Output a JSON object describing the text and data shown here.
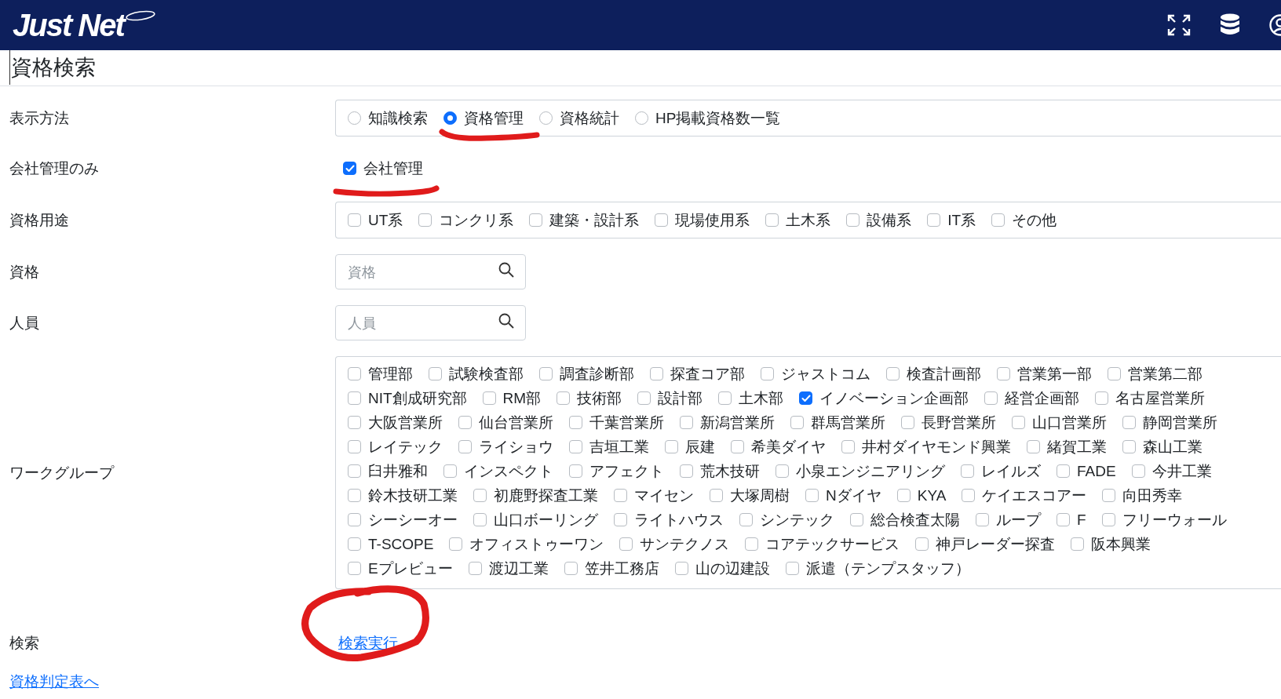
{
  "header": {
    "logo": "Just Net"
  },
  "page_title": "資格検索",
  "rows": [
    {
      "kind": "radio",
      "label": "表示方法",
      "options": [
        {
          "label": "知識検索",
          "selected": false
        },
        {
          "label": "資格管理",
          "selected": true
        },
        {
          "label": "資格統計",
          "selected": false
        },
        {
          "label": "HP掲載資格数一覧",
          "selected": false
        }
      ]
    },
    {
      "kind": "check",
      "label": "会社管理のみ",
      "options": [
        {
          "label": "会社管理",
          "checked": true
        }
      ]
    },
    {
      "kind": "checks",
      "label": "資格用途",
      "options": [
        {
          "label": "UT系",
          "checked": false
        },
        {
          "label": "コンクリ系",
          "checked": false
        },
        {
          "label": "建築・設計系",
          "checked": false
        },
        {
          "label": "現場使用系",
          "checked": false
        },
        {
          "label": "土木系",
          "checked": false
        },
        {
          "label": "設備系",
          "checked": false
        },
        {
          "label": "IT系",
          "checked": false
        },
        {
          "label": "その他",
          "checked": false
        }
      ]
    },
    {
      "kind": "search",
      "label": "資格",
      "placeholder": "資格"
    },
    {
      "kind": "search",
      "label": "人員",
      "placeholder": "人員"
    },
    {
      "kind": "grid",
      "label": "ワークグループ",
      "lines": [
        {
          "options": [
            {
              "label": "管理部",
              "checked": false
            },
            {
              "label": "試験検査部",
              "checked": false
            },
            {
              "label": "調査診断部",
              "checked": false
            },
            {
              "label": "探査コア部",
              "checked": false
            },
            {
              "label": "ジャストコム",
              "checked": false
            },
            {
              "label": "検査計画部",
              "checked": false
            },
            {
              "label": "営業第一部",
              "checked": false
            },
            {
              "label": "営業第二部",
              "checked": false
            }
          ]
        },
        {
          "options": [
            {
              "label": "NIT創成研究部",
              "checked": false
            },
            {
              "label": "RM部",
              "checked": false
            },
            {
              "label": "技術部",
              "checked": false
            },
            {
              "label": "設計部",
              "checked": false
            },
            {
              "label": "土木部",
              "checked": false
            },
            {
              "label": "イノベーション企画部",
              "checked": true
            },
            {
              "label": "経営企画部",
              "checked": false
            },
            {
              "label": "名古屋営業所",
              "checked": false
            }
          ]
        },
        {
          "options": [
            {
              "label": "大阪営業所",
              "checked": false
            },
            {
              "label": "仙台営業所",
              "checked": false
            },
            {
              "label": "千葉営業所",
              "checked": false
            },
            {
              "label": "新潟営業所",
              "checked": false
            },
            {
              "label": "群馬営業所",
              "checked": false
            },
            {
              "label": "長野営業所",
              "checked": false
            },
            {
              "label": "山口営業所",
              "checked": false
            },
            {
              "label": "静岡営業所",
              "checked": false
            }
          ]
        },
        {
          "options": [
            {
              "label": "レイテック",
              "checked": false
            },
            {
              "label": "ライショウ",
              "checked": false
            },
            {
              "label": "吉垣工業",
              "checked": false
            },
            {
              "label": "辰建",
              "checked": false
            },
            {
              "label": "希美ダイヤ",
              "checked": false
            },
            {
              "label": "井村ダイヤモンド興業",
              "checked": false
            },
            {
              "label": "緒賀工業",
              "checked": false
            },
            {
              "label": "森山工業",
              "checked": false
            }
          ]
        },
        {
          "options": [
            {
              "label": "臼井雅和",
              "checked": false
            },
            {
              "label": "インスペクト",
              "checked": false
            },
            {
              "label": "アフェクト",
              "checked": false
            },
            {
              "label": "荒木技研",
              "checked": false
            },
            {
              "label": "小泉エンジニアリング",
              "checked": false
            },
            {
              "label": "レイルズ",
              "checked": false
            },
            {
              "label": "FADE",
              "checked": false
            },
            {
              "label": "今井工業",
              "checked": false
            }
          ]
        },
        {
          "options": [
            {
              "label": "鈴木技研工業",
              "checked": false
            },
            {
              "label": "初鹿野探査工業",
              "checked": false
            },
            {
              "label": "マイセン",
              "checked": false
            },
            {
              "label": "大塚周樹",
              "checked": false
            },
            {
              "label": "Nダイヤ",
              "checked": false
            },
            {
              "label": "KYA",
              "checked": false
            },
            {
              "label": "ケイエスコアー",
              "checked": false
            },
            {
              "label": "向田秀幸",
              "checked": false
            }
          ]
        },
        {
          "options": [
            {
              "label": "シーシーオー",
              "checked": false
            },
            {
              "label": "山口ボーリング",
              "checked": false
            },
            {
              "label": "ライトハウス",
              "checked": false
            },
            {
              "label": "シンテック",
              "checked": false
            },
            {
              "label": "総合検査太陽",
              "checked": false
            },
            {
              "label": "ループ",
              "checked": false
            },
            {
              "label": "F",
              "checked": false
            },
            {
              "label": "フリーウォール",
              "checked": false
            }
          ]
        },
        {
          "options": [
            {
              "label": "T-SCOPE",
              "checked": false
            },
            {
              "label": "オフィストゥーワン",
              "checked": false
            },
            {
              "label": "サンテクノス",
              "checked": false
            },
            {
              "label": "コアテックサービス",
              "checked": false
            },
            {
              "label": "神戸レーダー探査",
              "checked": false
            },
            {
              "label": "阪本興業",
              "checked": false
            }
          ]
        },
        {
          "options": [
            {
              "label": "Eプレビュー",
              "checked": false
            },
            {
              "label": "渡辺工業",
              "checked": false
            },
            {
              "label": "笠井工務店",
              "checked": false
            },
            {
              "label": "山の辺建設",
              "checked": false
            },
            {
              "label": "派遣（テンプスタッフ）",
              "checked": false
            }
          ]
        }
      ]
    },
    {
      "kind": "link",
      "label": "検索",
      "link": "検索実行"
    }
  ],
  "footer_link": "資格判定表へ"
}
